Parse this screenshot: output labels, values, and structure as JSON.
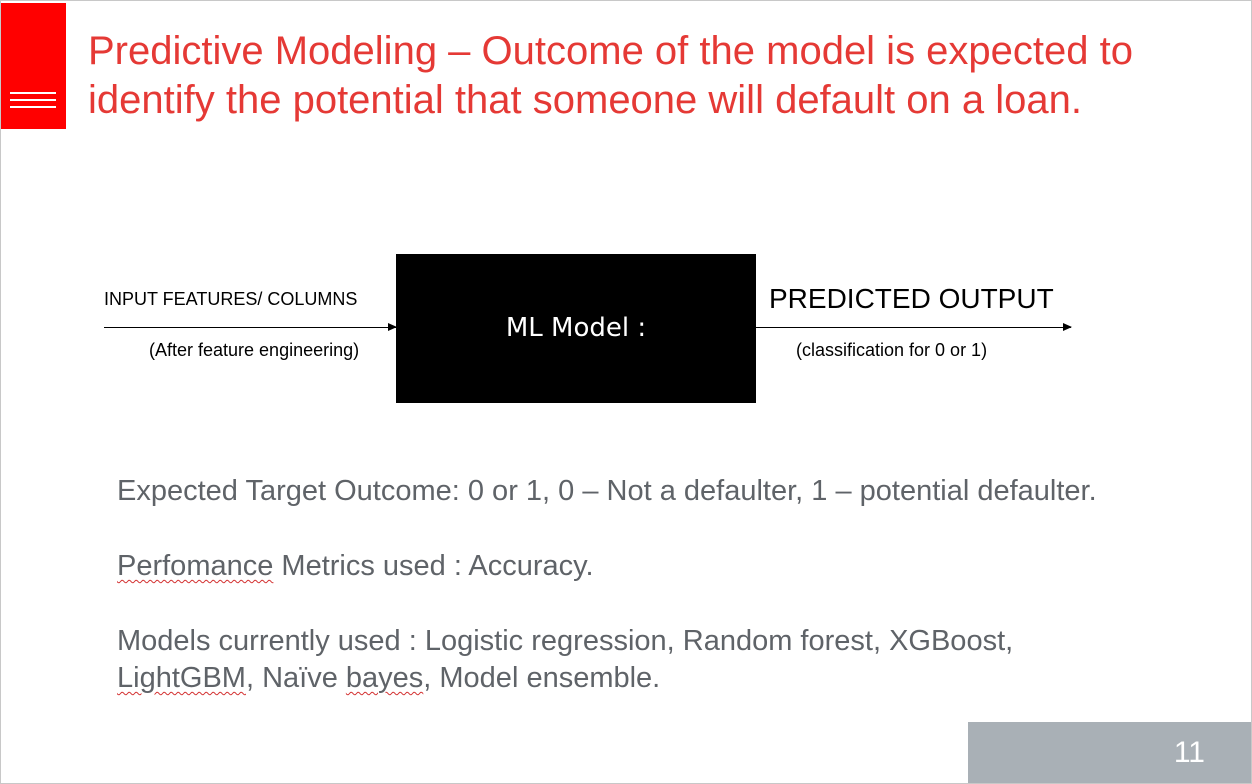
{
  "slide": {
    "title": "Predictive Modeling – Outcome of the model is expected to identify the potential that someone will default on a loan.",
    "diagram": {
      "input_label": "INPUT FEATURES/ COLUMNS",
      "input_sub": "(After feature engineering)",
      "model_label": "ML Model :",
      "output_label": "PREDICTED OUTPUT",
      "output_sub": "(classification for 0 or 1)"
    },
    "line1": "Expected Target Outcome: 0 or 1, 0 – Not a defaulter, 1 – potential defaulter.",
    "line2_word1": "Perfomance",
    "line2_rest": " Metrics used :  Accuracy.",
    "line3_part1": "Models currently used : Logistic regression, Random forest, XGBoost,",
    "line3_word_lightgbm": "LightGBM",
    "line3_mid": ", Naïve ",
    "line3_word_bayes": "bayes",
    "line3_end": ", Model ensemble.",
    "page_number": "11"
  },
  "colors": {
    "accent_red": "#ff0000",
    "title_red": "#e53935",
    "body_gray": "#5f6368",
    "footer_gray": "#a9b0b6"
  },
  "icons": {
    "menu": "hamburger-menu-icon"
  }
}
